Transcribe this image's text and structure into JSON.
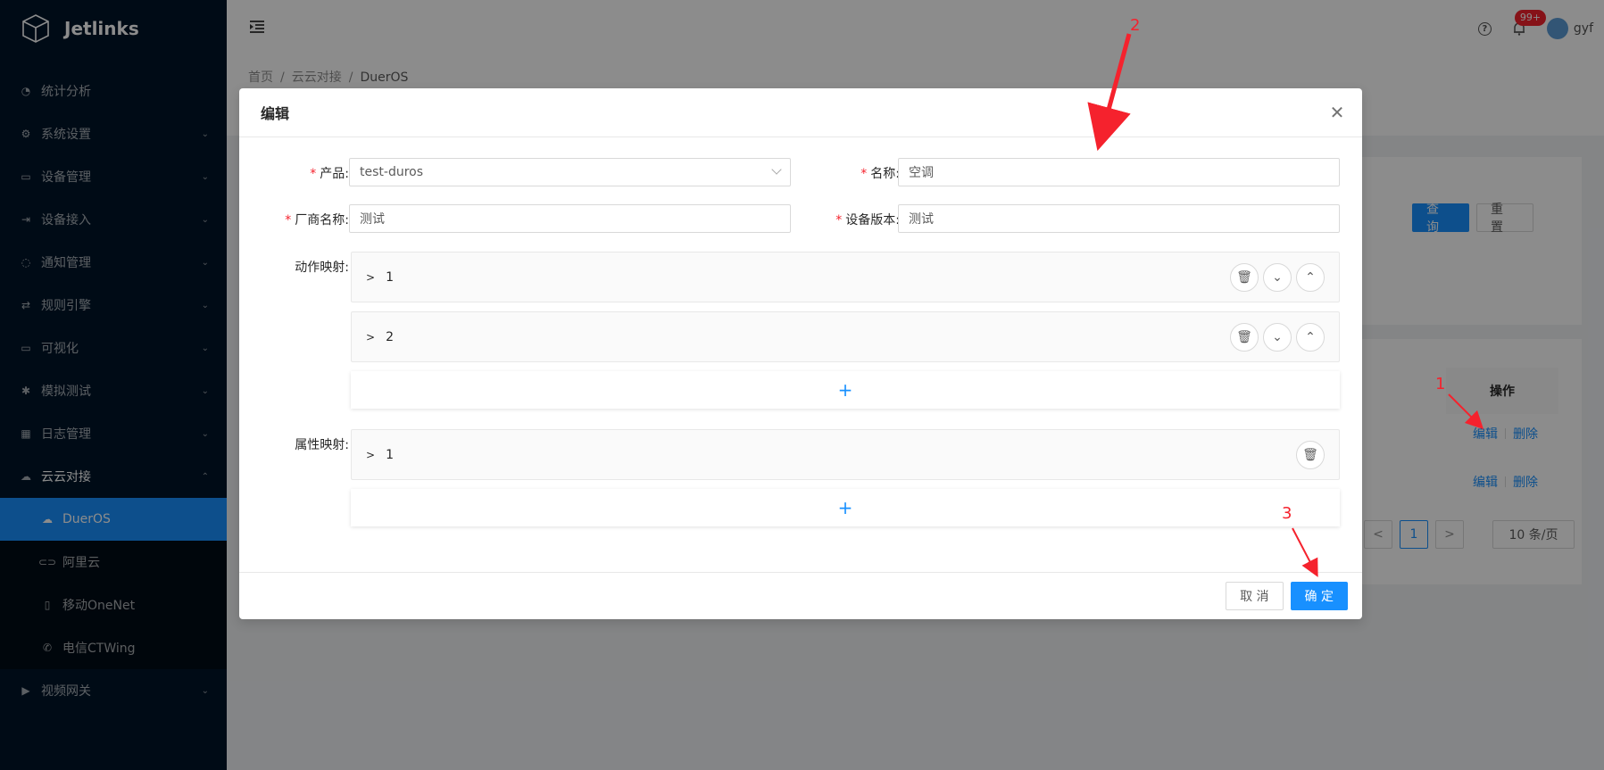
{
  "app": {
    "logo_text": "Jetlinks"
  },
  "sidebar": {
    "items": [
      {
        "label": "统计分析",
        "icon": "dashboard-icon",
        "has_children": false
      },
      {
        "label": "系统设置",
        "icon": "gear-icon",
        "has_children": true
      },
      {
        "label": "设备管理",
        "icon": "device-icon",
        "has_children": true
      },
      {
        "label": "设备接入",
        "icon": "login-icon",
        "has_children": true
      },
      {
        "label": "通知管理",
        "icon": "message-icon",
        "has_children": true
      },
      {
        "label": "规则引擎",
        "icon": "retweet-icon",
        "has_children": true
      },
      {
        "label": "可视化",
        "icon": "desktop-icon",
        "has_children": true
      },
      {
        "label": "模拟测试",
        "icon": "bug-icon",
        "has_children": true
      },
      {
        "label": "日志管理",
        "icon": "calendar-icon",
        "has_children": true
      },
      {
        "label": "云云对接",
        "icon": "cloud-icon",
        "has_children": true,
        "open": true
      },
      {
        "label": "视频网关",
        "icon": "video-icon",
        "has_children": true
      }
    ],
    "cloud_sub": [
      {
        "label": "DuerOS",
        "icon": "cloud-icon",
        "active": true
      },
      {
        "label": "阿里云",
        "icon": "link-icon"
      },
      {
        "label": "移动OneNet",
        "icon": "mobile-icon"
      },
      {
        "label": "电信CTWing",
        "icon": "phone-icon"
      }
    ]
  },
  "header": {
    "badge": "99+",
    "user": "gyf"
  },
  "breadcrumb": {
    "home": "首页",
    "parent": "云云对接",
    "current": "DuerOS"
  },
  "search": {
    "query_label": "查 询",
    "reset_label": "重 置"
  },
  "table": {
    "op_header": "操作",
    "rows": [
      {
        "edit": "编辑",
        "delete": "删除"
      },
      {
        "edit": "编辑",
        "delete": "删除"
      }
    ]
  },
  "pagination": {
    "prev": "<",
    "page": "1",
    "next": ">",
    "size": "10 条/页"
  },
  "modal": {
    "title": "编辑",
    "fields": {
      "product_label": "产品:",
      "product_value": "test-duros",
      "name_label": "名称:",
      "name_value": "空调",
      "vendor_label": "厂商名称:",
      "vendor_value": "测试",
      "version_label": "设备版本:",
      "version_value": "测试",
      "action_label": "动作映射:",
      "property_label": "属性映射:"
    },
    "action_panels": [
      {
        "title": "1"
      },
      {
        "title": "2"
      }
    ],
    "property_panels": [
      {
        "title": "1"
      }
    ],
    "add_symbol": "+",
    "cancel_label": "取 消",
    "ok_label": "确 定"
  },
  "annotations": {
    "n1": "1",
    "n2": "2",
    "n3": "3",
    "color": "#f5222d"
  },
  "colors": {
    "primary": "#1890ff",
    "sidebar": "#001529",
    "danger": "#f5222d"
  }
}
